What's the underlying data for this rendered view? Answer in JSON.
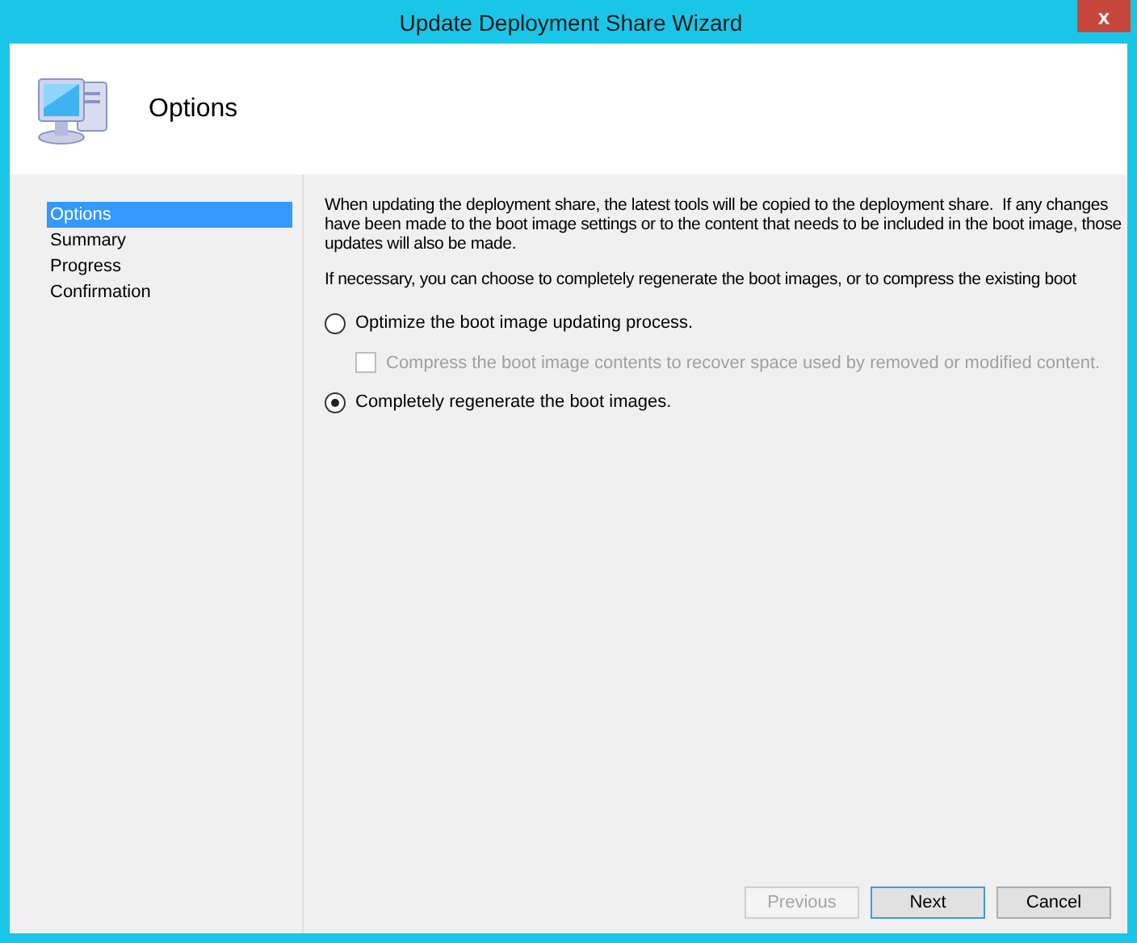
{
  "window": {
    "title": "Update Deployment Share Wizard",
    "close": "x"
  },
  "header": {
    "title": "Options"
  },
  "sidebar": {
    "items": [
      {
        "label": "Options",
        "selected": true
      },
      {
        "label": "Summary",
        "selected": false
      },
      {
        "label": "Progress",
        "selected": false
      },
      {
        "label": "Confirmation",
        "selected": false
      }
    ]
  },
  "content": {
    "paragraphs": [
      "When updating the deployment share, the latest tools will be copied to the deployment share.  If any changes have been made to the boot image settings or to the content that needs to be included in the boot image, those updates will also be made.",
      "If necessary, you can choose to completely regenerate the boot images, or to compress the existing boot"
    ],
    "options": [
      {
        "kind": "radio",
        "label": "Optimize the boot image updating process.",
        "selected": false,
        "disabled": false
      },
      {
        "kind": "checkbox",
        "label": "Compress the boot image contents to recover space used by removed or modified content.",
        "checked": false,
        "disabled": true
      },
      {
        "kind": "radio",
        "label": "Completely regenerate the boot images.",
        "selected": true,
        "disabled": false
      }
    ]
  },
  "buttons": [
    {
      "label": "Previous",
      "disabled": true,
      "default": false
    },
    {
      "label": "Next",
      "disabled": false,
      "default": true
    },
    {
      "label": "Cancel",
      "disabled": false,
      "default": false
    }
  ]
}
